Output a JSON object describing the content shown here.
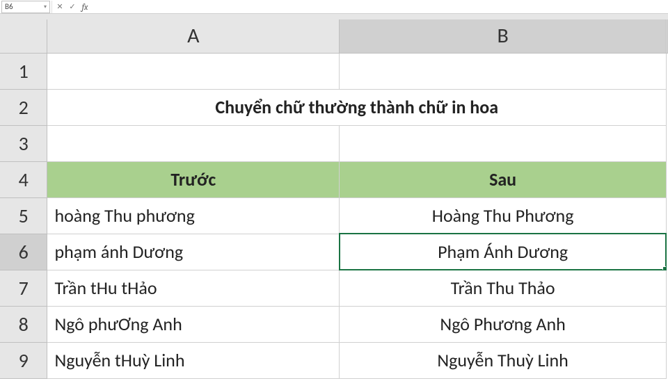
{
  "formula_bar": {
    "name_box": "B6",
    "cancel_icon": "✕",
    "confirm_icon": "✓",
    "fx_label": "fx",
    "formula_value": ""
  },
  "columns": {
    "A": "A",
    "B": "B"
  },
  "rows": [
    "1",
    "2",
    "3",
    "4",
    "5",
    "6",
    "7",
    "8",
    "9"
  ],
  "title": "Chuyển chữ thường thành chữ in hoa",
  "headers": {
    "before": "Trước",
    "after": "Sau"
  },
  "data": [
    {
      "before": "hoàng Thu phương",
      "after": "Hoàng Thu Phương"
    },
    {
      "before": "phạm ánh Dương",
      "after": "Phạm Ánh Dương"
    },
    {
      "before": "Trần tHu tHảo",
      "after": "Trần Thu Thảo"
    },
    {
      "before": "Ngô phưƠng Anh",
      "after": "Ngô Phương Anh"
    },
    {
      "before": "Nguyễn tHuỳ Linh",
      "after": "Nguyễn Thuỳ Linh"
    }
  ],
  "selected_cell": "B6"
}
